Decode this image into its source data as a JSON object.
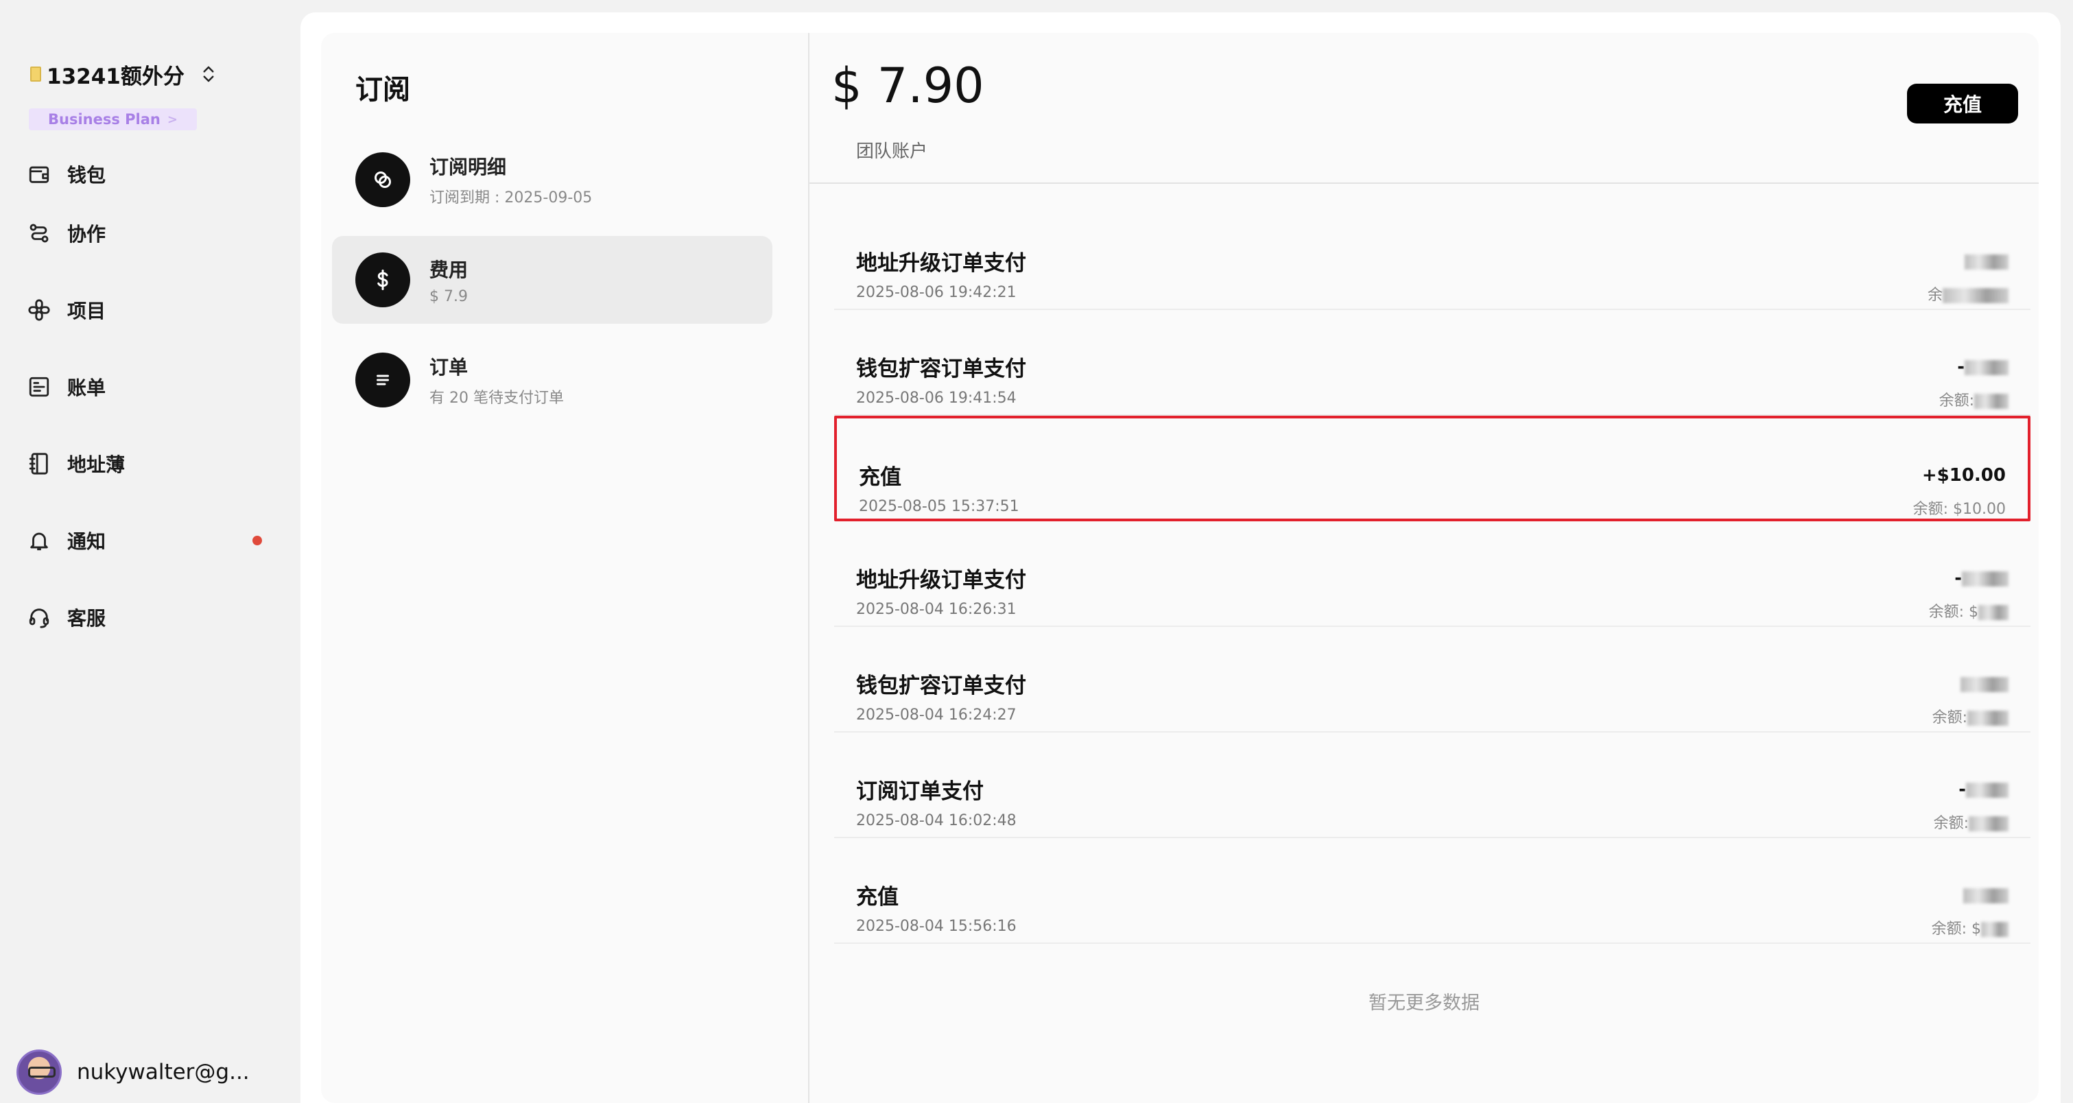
{
  "sidebar": {
    "workspace_name": "13241额外分",
    "plan_label": "Business Plan",
    "plan_chevron": ">",
    "items": [
      {
        "label": "钱包",
        "icon": "wallet-icon"
      },
      {
        "label": "协作",
        "icon": "collaboration-icon"
      },
      {
        "label": "项目",
        "icon": "project-icon"
      },
      {
        "label": "账单",
        "icon": "bill-icon"
      },
      {
        "label": "地址薄",
        "icon": "address-book-icon"
      },
      {
        "label": "通知",
        "icon": "bell-icon"
      },
      {
        "label": "客服",
        "icon": "headset-icon"
      }
    ],
    "user_name": "nukywalter@g..."
  },
  "subpanel": {
    "title": "订阅",
    "items": [
      {
        "title": "订阅明细",
        "subtitle": "订阅到期 : 2025-09-05",
        "icon": "subscription-icon"
      },
      {
        "title": "费用",
        "subtitle": "$ 7.9",
        "icon": "dollar-icon"
      },
      {
        "title": "订单",
        "subtitle": "有 20 笔待支付订单",
        "icon": "list-icon"
      }
    ]
  },
  "detail": {
    "balance": "$ 7.90",
    "balance_label": "团队账户",
    "recharge_label": "充值",
    "transactions": [
      {
        "title": "地址升级订单支付",
        "time": "2025-08-06 19:42:21",
        "amount": "",
        "balance": "余"
      },
      {
        "title": "钱包扩容订单支付",
        "time": "2025-08-06 19:41:54",
        "amount": "-",
        "balance": "余额:"
      },
      {
        "title": "充值",
        "time": "2025-08-05 15:37:51",
        "amount": "+$10.00",
        "balance": "余额: $10.00"
      },
      {
        "title": "地址升级订单支付",
        "time": "2025-08-04 16:26:31",
        "amount": "-",
        "balance": "余额: $"
      },
      {
        "title": "钱包扩容订单支付",
        "time": "2025-08-04 16:24:27",
        "amount": "",
        "balance": "余额:"
      },
      {
        "title": "订阅订单支付",
        "time": "2025-08-04 16:02:48",
        "amount": "-",
        "balance": "余额:"
      },
      {
        "title": "充值",
        "time": "2025-08-04 15:56:16",
        "amount": "",
        "balance": "余额: $"
      }
    ],
    "no_more": "暂无更多数据"
  },
  "colors": {
    "accent_black": "#000000",
    "plan_badge_bg": "#ece2fb",
    "plan_badge_text": "#a880e6",
    "notification_dot": "#e04a3b",
    "highlight_border": "#e2202c"
  }
}
